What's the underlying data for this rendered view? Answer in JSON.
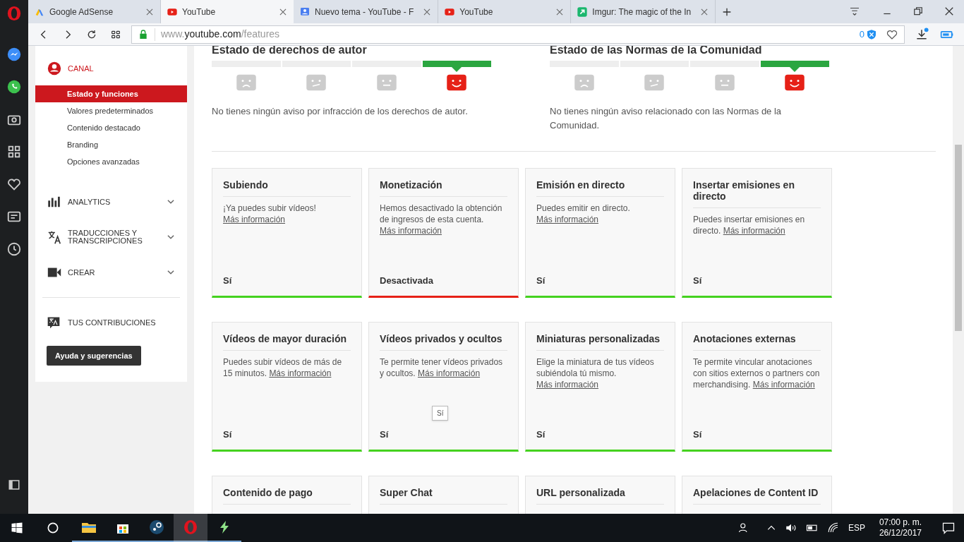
{
  "browser": {
    "tabs": [
      {
        "label": "Google AdSense",
        "selected": false
      },
      {
        "label": "YouTube",
        "selected": true
      },
      {
        "label": "Nuevo tema - YouTube - F",
        "selected": false
      },
      {
        "label": "YouTube",
        "selected": false
      },
      {
        "label": "Imgur: The magic of the In",
        "selected": false
      }
    ],
    "url": {
      "host_prefix": "www.",
      "host": "youtube.com",
      "path": "/features"
    },
    "blocked_count": "0"
  },
  "sidebar": {
    "sections": [
      {
        "label": "CANAL",
        "expanded": true,
        "active": true,
        "children": [
          {
            "label": "Estado y funciones",
            "selected": true
          },
          {
            "label": "Valores predeterminados",
            "selected": false
          },
          {
            "label": "Contenido destacado",
            "selected": false
          },
          {
            "label": "Branding",
            "selected": false
          },
          {
            "label": "Opciones avanzadas",
            "selected": false
          }
        ]
      },
      {
        "label": "ANALYTICS",
        "expanded": false,
        "active": false
      },
      {
        "label": "TRADUCCIONES Y TRANSCRIPCIONES",
        "expanded": false,
        "active": false
      },
      {
        "label": "CREAR",
        "expanded": false,
        "active": false
      }
    ],
    "contributions": "TUS CONTRIBUCIONES",
    "help_button": "Ayuda y sugerencias"
  },
  "status": [
    {
      "title": "Estado de derechos de autor",
      "levels": [
        {
          "selected": false
        },
        {
          "selected": false
        },
        {
          "selected": false
        },
        {
          "selected": true
        }
      ],
      "message": "No tienes ningún aviso por infracción de los derechos de autor."
    },
    {
      "title": "Estado de las Normas de la Comunidad",
      "levels": [
        {
          "selected": false
        },
        {
          "selected": false
        },
        {
          "selected": false
        },
        {
          "selected": true
        }
      ],
      "message": "No tienes ningún aviso relacionado con las Normas de la Comunidad."
    }
  ],
  "features": [
    {
      "title": "Subiendo",
      "text": "¡Ya puedes subir vídeos!",
      "link": "Más información",
      "state": "Sí",
      "enabled": true
    },
    {
      "title": "Monetización",
      "text": "Hemos desactivado la obtención de ingresos de esta cuenta.",
      "link": "Más información",
      "state": "Desactivada",
      "enabled": false
    },
    {
      "title": "Emisión en directo",
      "text": "Puedes emitir en directo.",
      "link": "Más información",
      "state": "Sí",
      "enabled": true
    },
    {
      "title": "Insertar emisiones en directo",
      "text": "Puedes insertar emisiones en directo.",
      "link": "Más información",
      "state": "Sí",
      "enabled": true
    },
    {
      "title": "Vídeos de mayor duración",
      "text": "Puedes subir vídeos de más de 15 minutos.",
      "link": "Más información",
      "state": "Sí",
      "enabled": true
    },
    {
      "title": "Vídeos privados y ocultos",
      "text": "Te permite tener vídeos privados y ocultos.",
      "link": "Más información",
      "state": "Sí",
      "enabled": true,
      "tooltip": "Sí"
    },
    {
      "title": "Miniaturas personalizadas",
      "text": "Elige la miniatura de tus vídeos subiéndola tú mismo.",
      "link": "Más información",
      "state": "Sí",
      "enabled": true
    },
    {
      "title": "Anotaciones externas",
      "text": "Te permite vincular anotaciones con sitios externos o partners con merchandising.",
      "link": "Más información",
      "state": "Sí",
      "enabled": true
    },
    {
      "title": "Contenido de pago"
    },
    {
      "title": "Super Chat"
    },
    {
      "title": "URL personalizada"
    },
    {
      "title": "Apelaciones de Content ID"
    }
  ],
  "taskbar": {
    "language": "ESP",
    "time": "07:00 p. m.",
    "date": "26/12/2017"
  }
}
